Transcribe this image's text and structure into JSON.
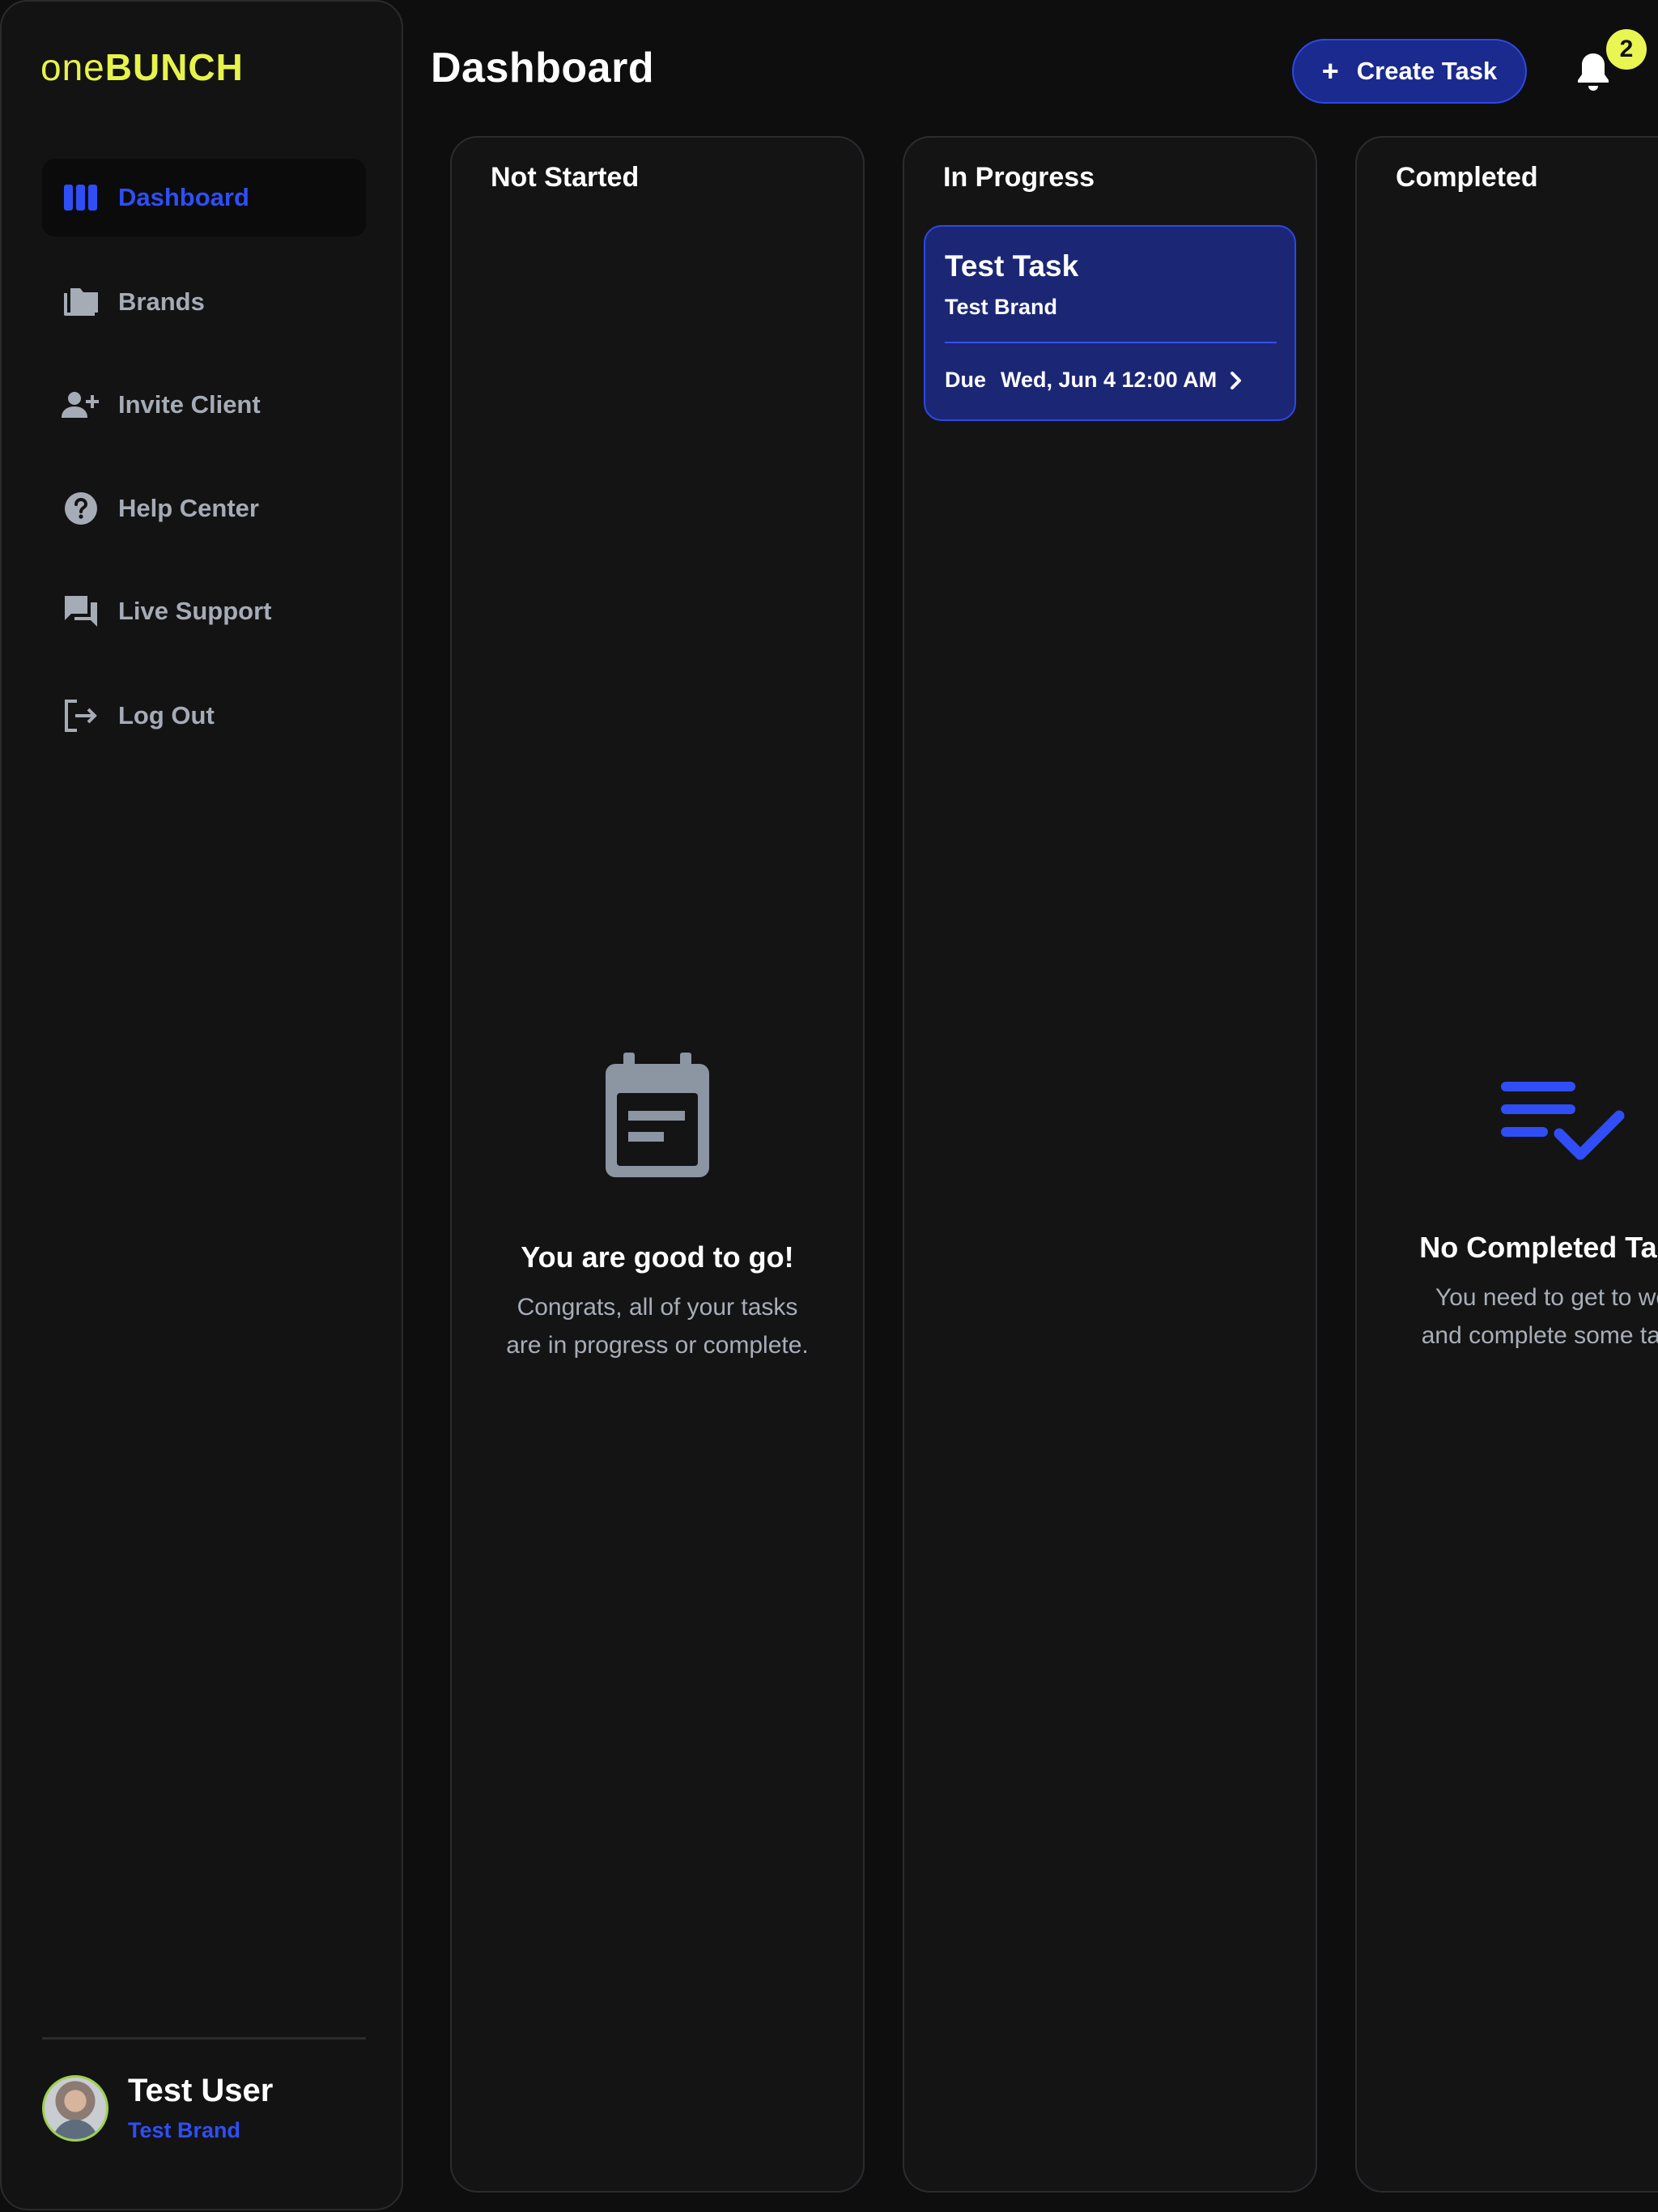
{
  "brand": {
    "logo_part1": "one",
    "logo_part2": "BUNCH",
    "logo_color": "#e6f34a"
  },
  "sidebar": {
    "items": [
      {
        "label": "Dashboard",
        "icon": "columns-icon",
        "active": true
      },
      {
        "label": "Brands",
        "icon": "folders-icon",
        "active": false
      },
      {
        "label": "Invite Client",
        "icon": "person-add-icon",
        "active": false
      },
      {
        "label": "Help Center",
        "icon": "help-circle-icon",
        "active": false
      },
      {
        "label": "Live Support",
        "icon": "chat-bubbles-icon",
        "active": false
      },
      {
        "label": "Log Out",
        "icon": "logout-icon",
        "active": false
      }
    ],
    "user": {
      "name": "Test User",
      "brand": "Test Brand"
    }
  },
  "header": {
    "title": "Dashboard",
    "create_task_label": "Create Task",
    "notification_count": "2"
  },
  "columns": {
    "not_started": {
      "title": "Not Started",
      "empty_title": "You are good to go!",
      "empty_line1": "Congrats, all of your tasks",
      "empty_line2": "are in progress or complete."
    },
    "in_progress": {
      "title": "In Progress",
      "tasks": [
        {
          "title": "Test Task",
          "brand": "Test Brand",
          "due_label": "Due",
          "due_date": "Wed, Jun 4 12:00 AM"
        }
      ]
    },
    "completed": {
      "title": "Completed",
      "empty_title": "No Completed Tasks",
      "empty_line1": "You need to get to work",
      "empty_line2": "and complete some tasks."
    }
  },
  "colors": {
    "accent_blue": "#2f4ef6",
    "card_blue": "#1b2775",
    "badge_yellow": "#e9f551",
    "muted_text": "#a8aeb8",
    "background": "#0e0e0f"
  }
}
